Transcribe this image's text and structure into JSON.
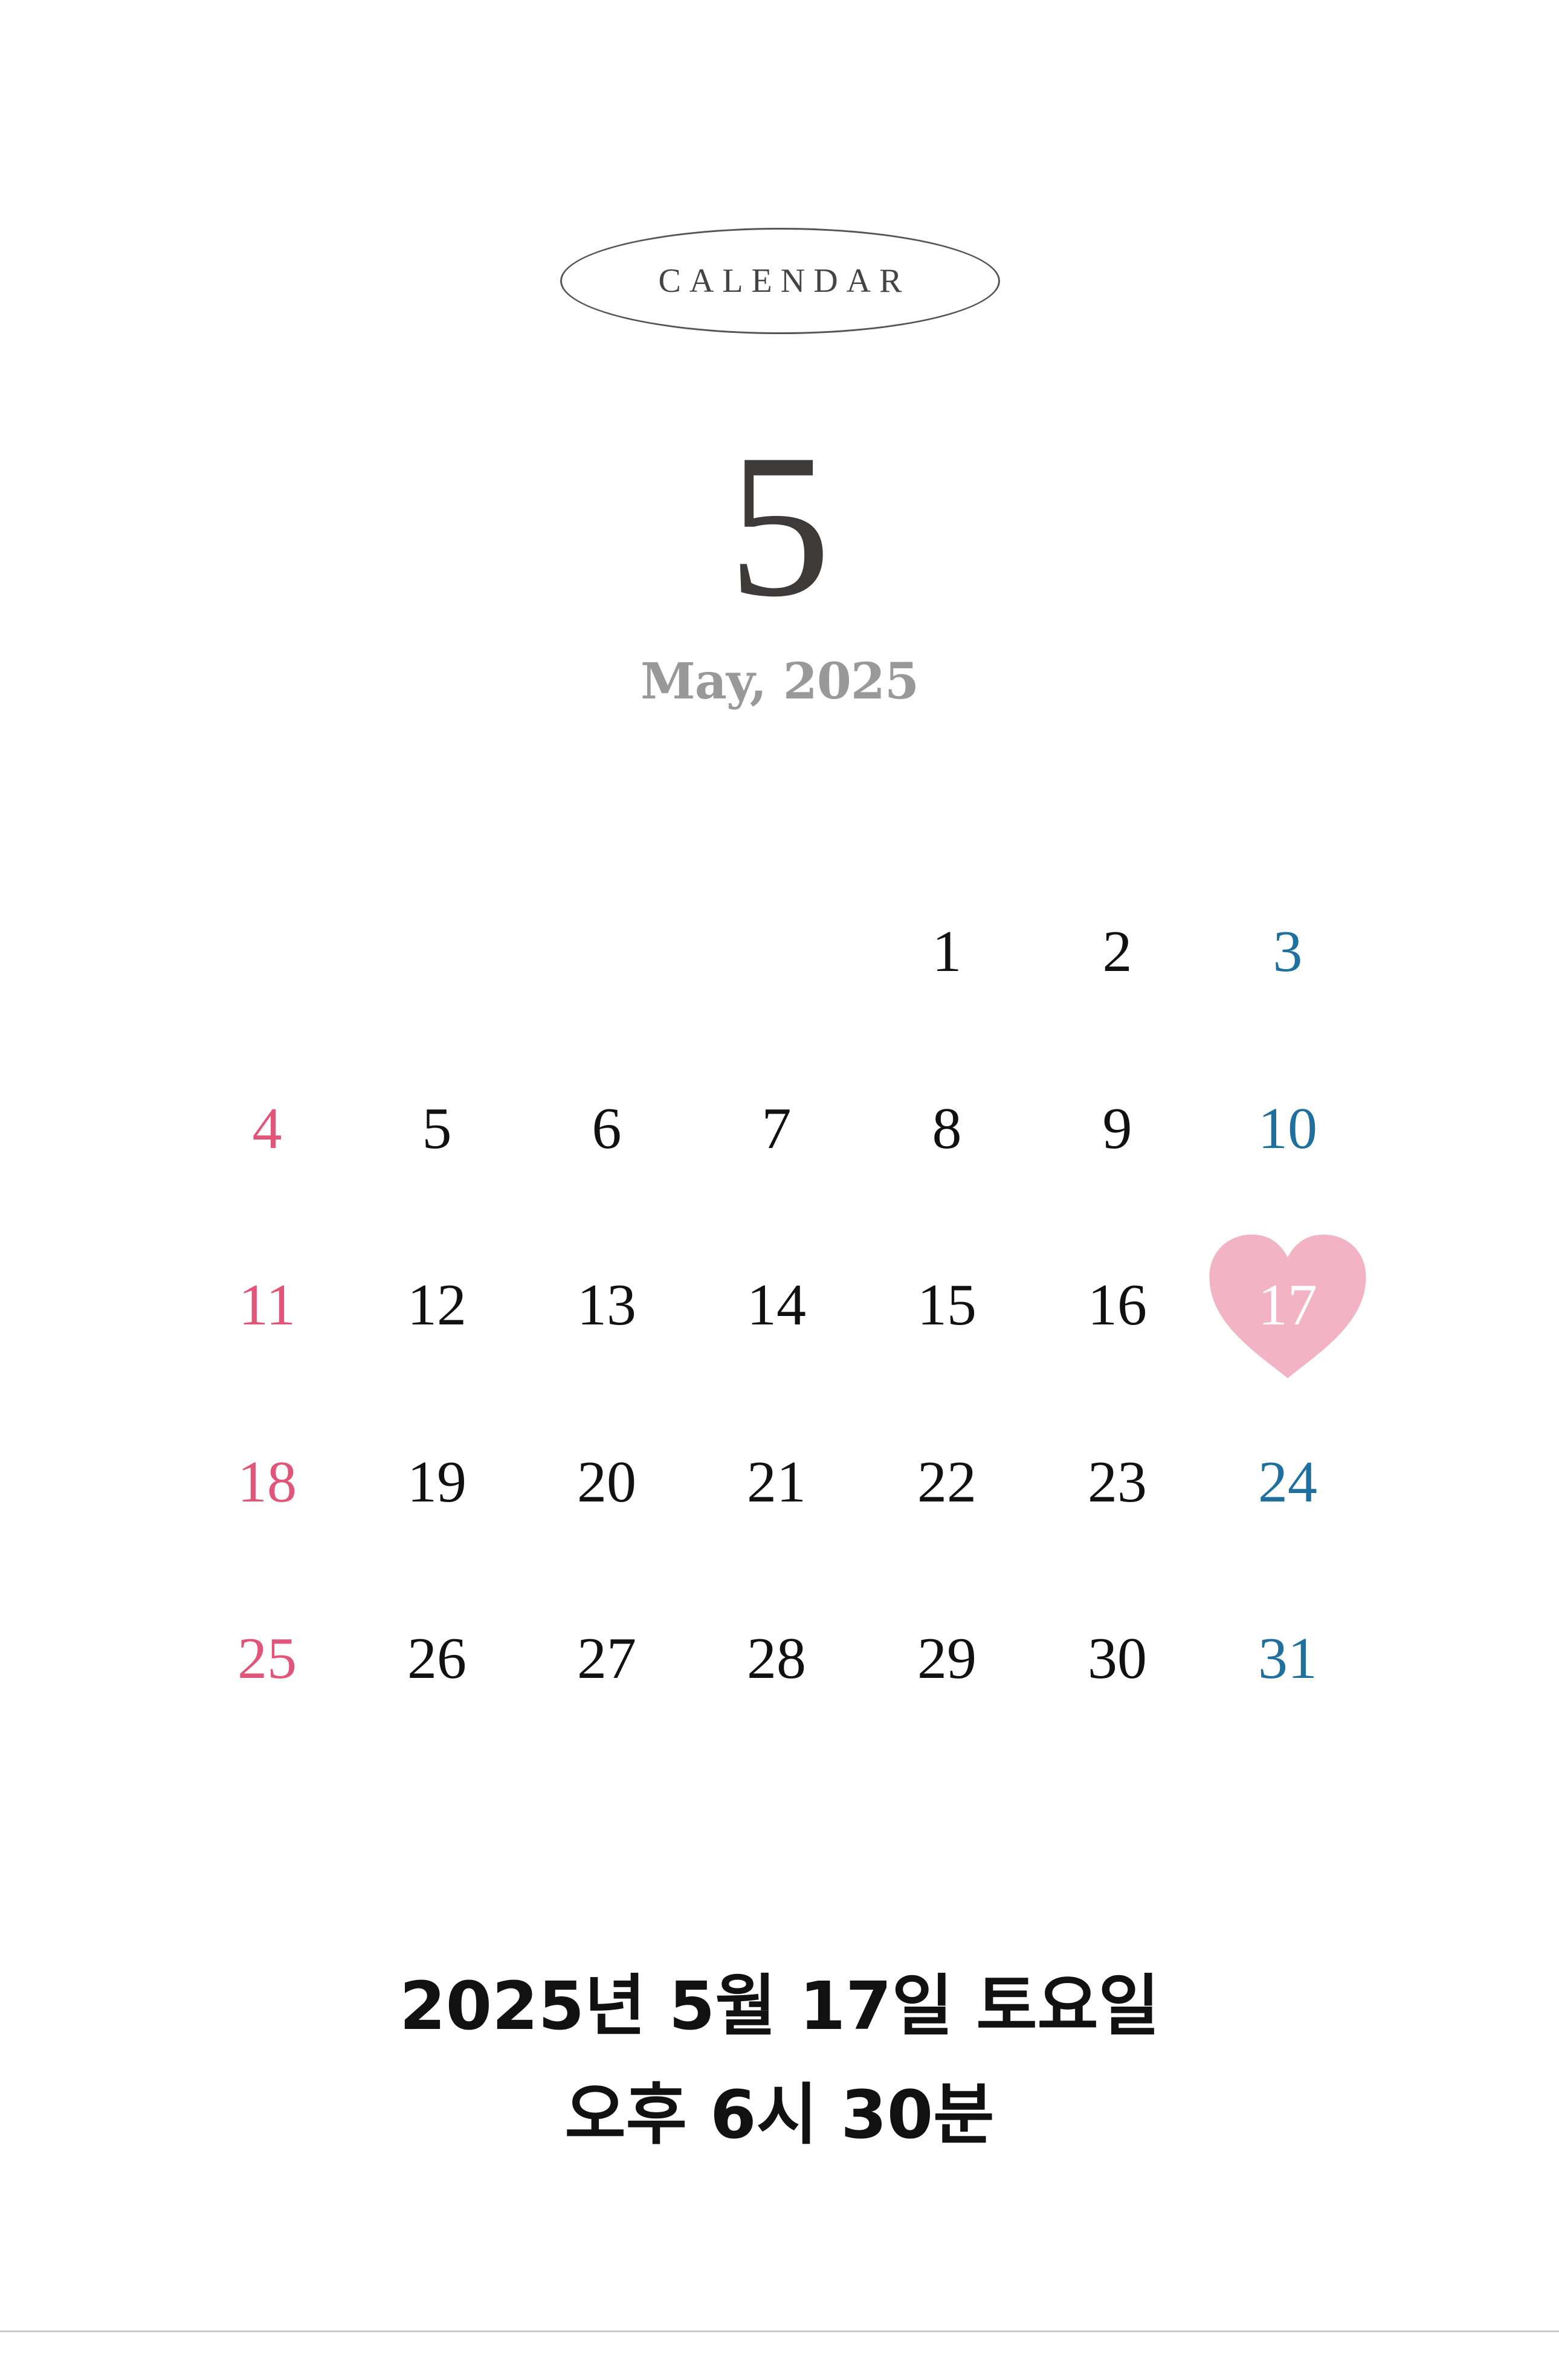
{
  "badge": {
    "label": "CALENDAR"
  },
  "month": {
    "number": "5",
    "subtitle": "May, 2025"
  },
  "calendar": {
    "days": [
      {
        "label": "1",
        "col": 4,
        "row": 0,
        "type": "weekday"
      },
      {
        "label": "2",
        "col": 5,
        "row": 0,
        "type": "weekday"
      },
      {
        "label": "3",
        "col": 6,
        "row": 0,
        "type": "saturday"
      },
      {
        "label": "4",
        "col": 0,
        "row": 1,
        "type": "sunday"
      },
      {
        "label": "5",
        "col": 1,
        "row": 1,
        "type": "weekday"
      },
      {
        "label": "6",
        "col": 2,
        "row": 1,
        "type": "weekday"
      },
      {
        "label": "7",
        "col": 3,
        "row": 1,
        "type": "weekday"
      },
      {
        "label": "8",
        "col": 4,
        "row": 1,
        "type": "weekday"
      },
      {
        "label": "9",
        "col": 5,
        "row": 1,
        "type": "weekday"
      },
      {
        "label": "10",
        "col": 6,
        "row": 1,
        "type": "saturday"
      },
      {
        "label": "11",
        "col": 0,
        "row": 2,
        "type": "sunday"
      },
      {
        "label": "12",
        "col": 1,
        "row": 2,
        "type": "weekday"
      },
      {
        "label": "13",
        "col": 2,
        "row": 2,
        "type": "weekday"
      },
      {
        "label": "14",
        "col": 3,
        "row": 2,
        "type": "weekday"
      },
      {
        "label": "15",
        "col": 4,
        "row": 2,
        "type": "weekday"
      },
      {
        "label": "16",
        "col": 5,
        "row": 2,
        "type": "weekday"
      },
      {
        "label": "17",
        "col": 6,
        "row": 2,
        "type": "selected"
      },
      {
        "label": "18",
        "col": 0,
        "row": 3,
        "type": "sunday"
      },
      {
        "label": "19",
        "col": 1,
        "row": 3,
        "type": "weekday"
      },
      {
        "label": "20",
        "col": 2,
        "row": 3,
        "type": "weekday"
      },
      {
        "label": "21",
        "col": 3,
        "row": 3,
        "type": "weekday"
      },
      {
        "label": "22",
        "col": 4,
        "row": 3,
        "type": "weekday"
      },
      {
        "label": "23",
        "col": 5,
        "row": 3,
        "type": "weekday"
      },
      {
        "label": "24",
        "col": 6,
        "row": 3,
        "type": "saturday"
      },
      {
        "label": "25",
        "col": 0,
        "row": 4,
        "type": "sunday"
      },
      {
        "label": "26",
        "col": 1,
        "row": 4,
        "type": "weekday"
      },
      {
        "label": "27",
        "col": 2,
        "row": 4,
        "type": "weekday"
      },
      {
        "label": "28",
        "col": 3,
        "row": 4,
        "type": "weekday"
      },
      {
        "label": "29",
        "col": 4,
        "row": 4,
        "type": "weekday"
      },
      {
        "label": "30",
        "col": 5,
        "row": 4,
        "type": "weekday"
      },
      {
        "label": "31",
        "col": 6,
        "row": 4,
        "type": "saturday"
      }
    ],
    "selected_marker": "heart-icon"
  },
  "event": {
    "date_line": "2025년 5월 17일 토요일",
    "time_line": "오후 6시 30분"
  },
  "colors": {
    "sunday": "#e05578",
    "saturday": "#1f6f9f",
    "weekday": "#111111",
    "heart": "#f2b3c4",
    "selected_text": "#ffffff"
  }
}
